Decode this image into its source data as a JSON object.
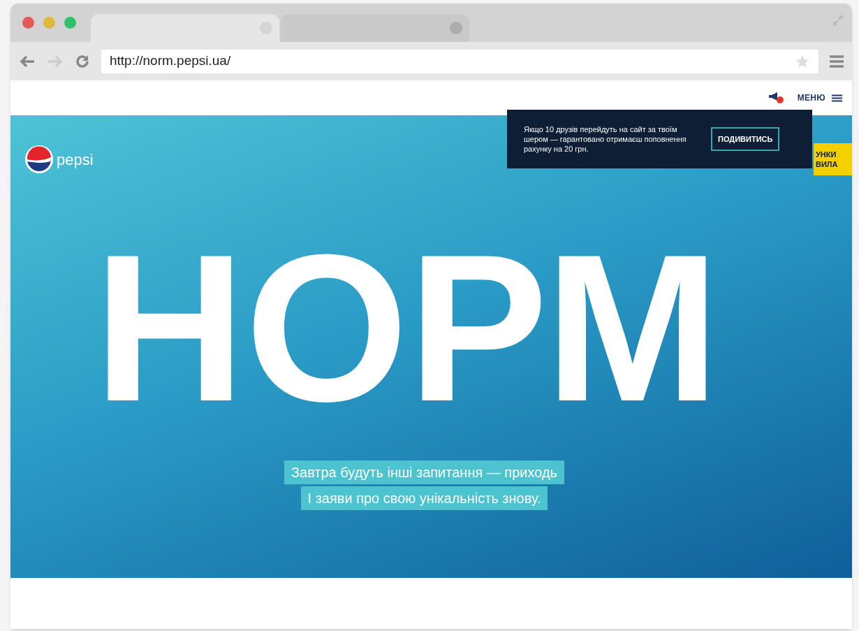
{
  "browser": {
    "tabs": [
      {
        "selected": true
      },
      {
        "selected": false
      }
    ],
    "back_disabled": false,
    "forward_disabled": true,
    "url": "http://norm.pepsi.ua/"
  },
  "header": {
    "menu_label": "МЕНЮ",
    "notification_badge": true
  },
  "popup": {
    "text": "Якщо 10 друзів перейдуть на сайт за твоїм шером — гарантовано отримаєш поповнення рахунку на 20 грн.",
    "button": "ПОДИВИТИСЬ"
  },
  "side_tab_lines": [
    "УНКИ",
    "ВИЛА"
  ],
  "hero": {
    "logo_text": "pepsi",
    "headline": "НОРМ",
    "caption_lines": [
      "Завтра будуть інші запитання — приходь",
      "І заяви про свою унікальність знову."
    ]
  }
}
